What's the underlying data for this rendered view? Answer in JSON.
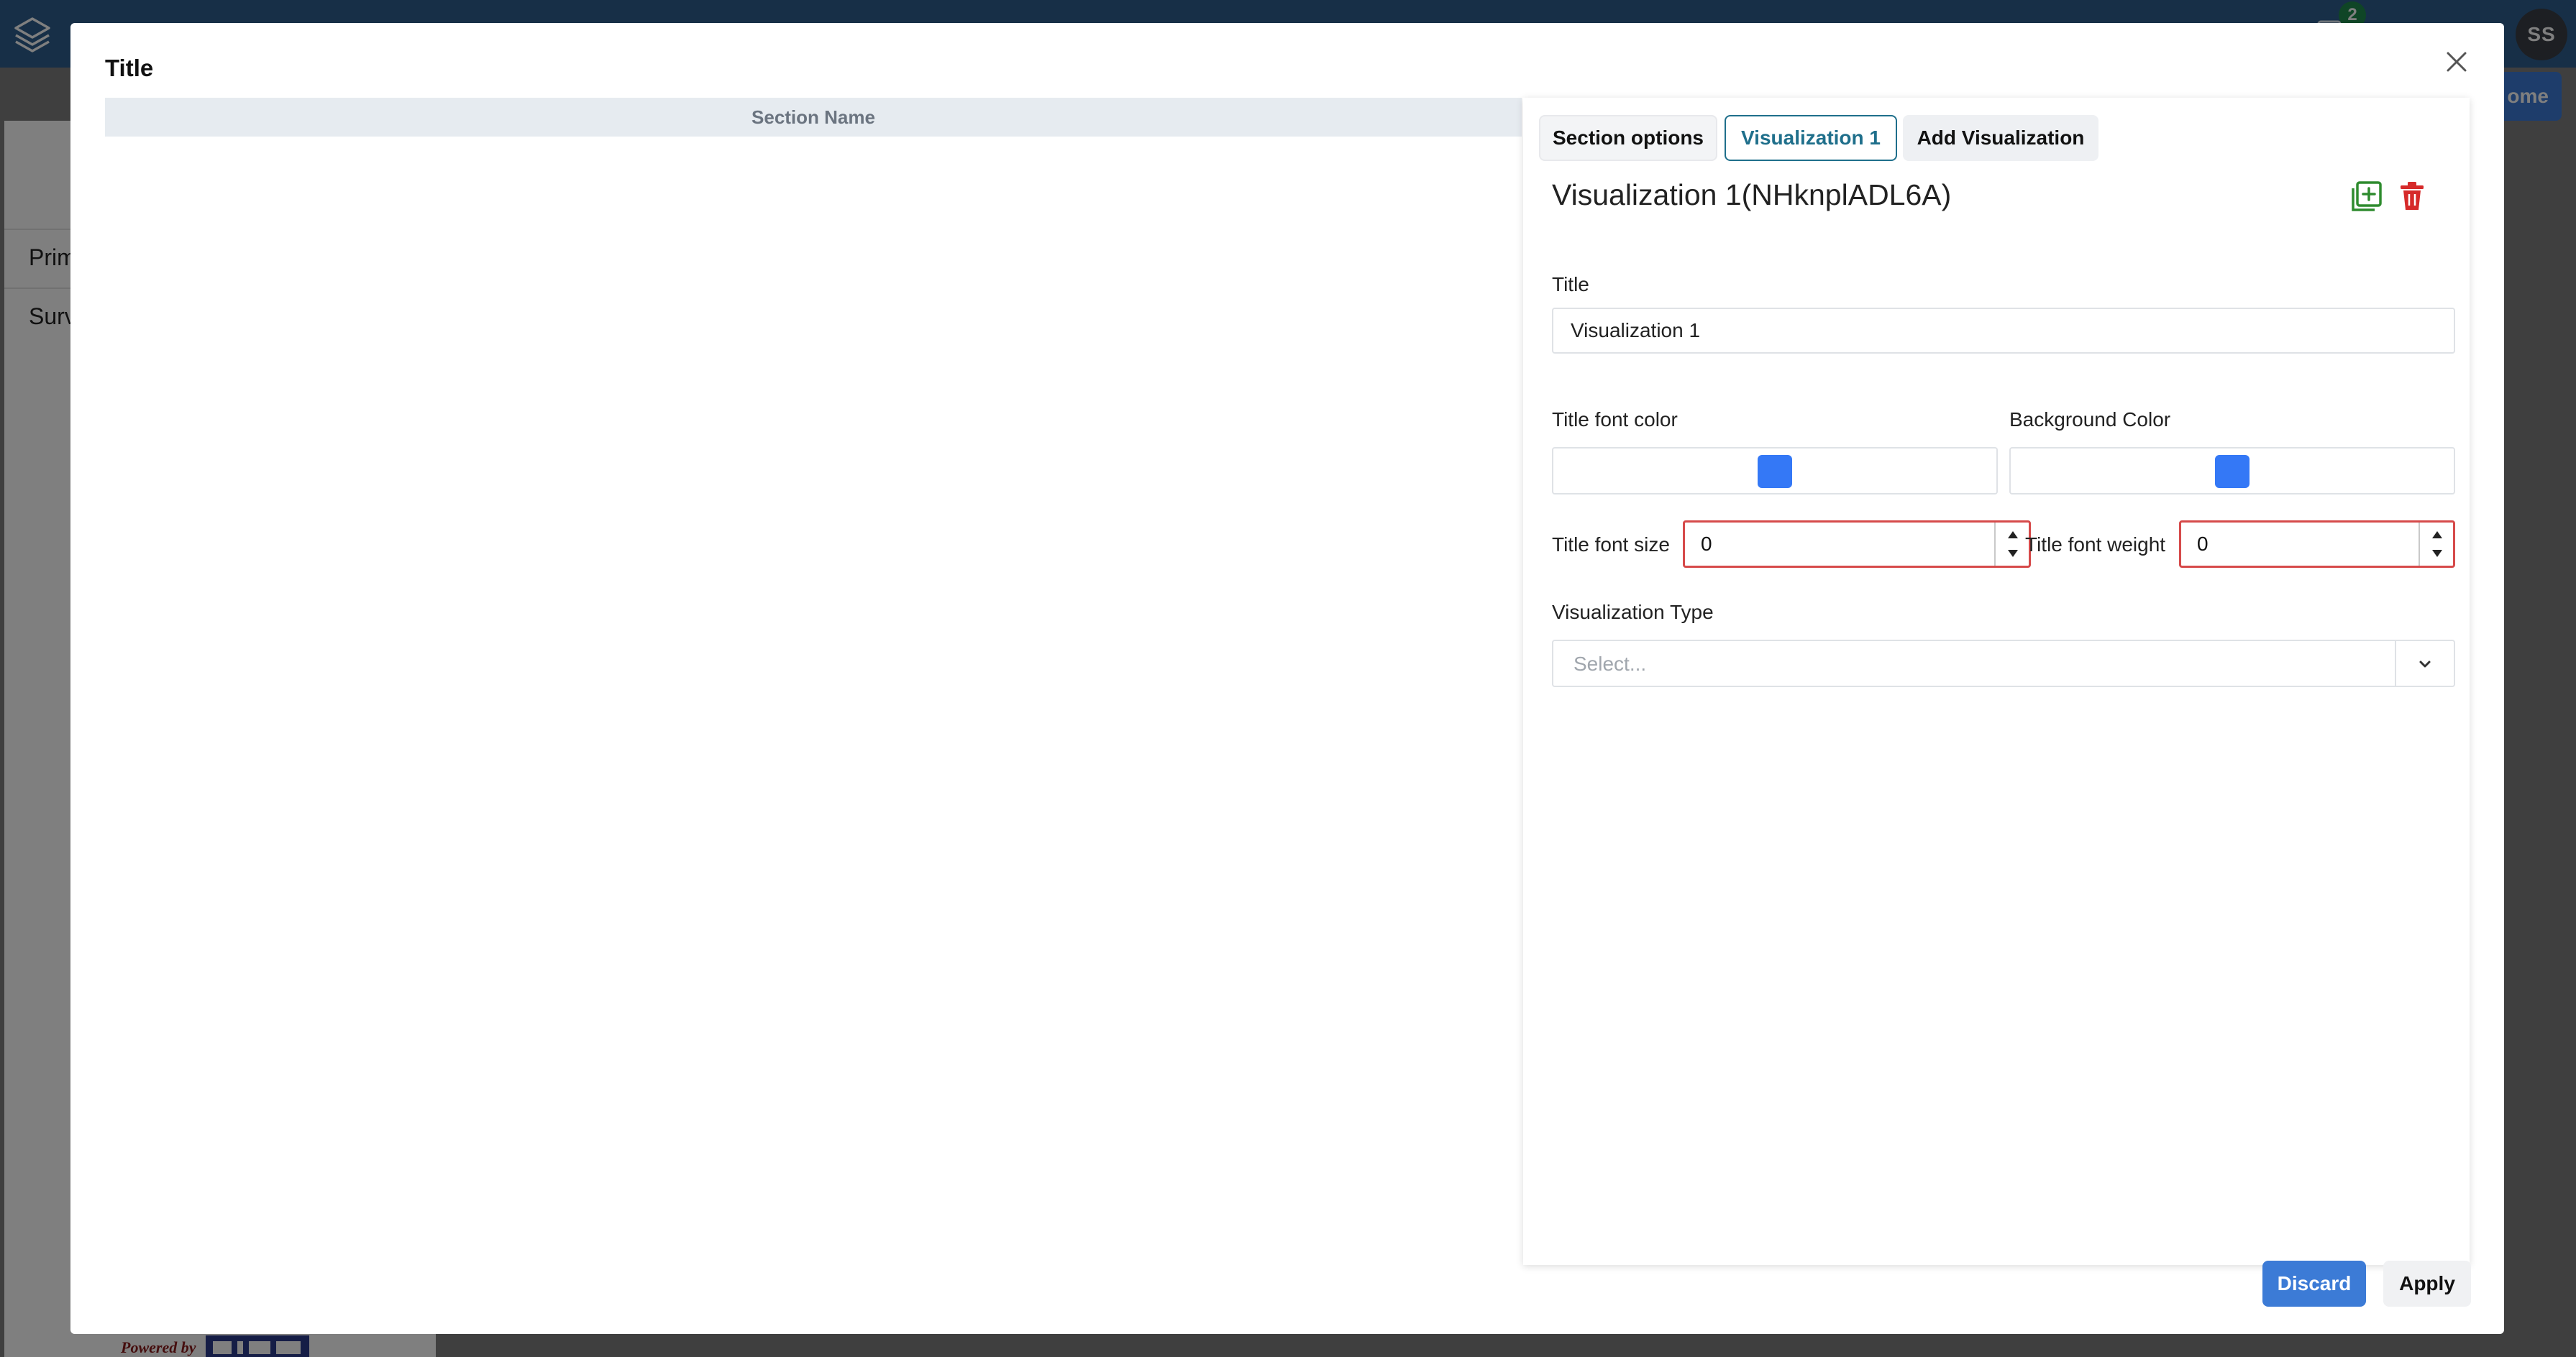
{
  "app": {
    "notification_count": "2",
    "avatar_initials": "SS",
    "background_list": [
      "Prim",
      "Surv"
    ],
    "home_button_label": "ome",
    "powered_by": "Powered by"
  },
  "modal": {
    "title": "Title",
    "section_name_header": "Section Name",
    "tabs": [
      {
        "label": "Section options",
        "active": false
      },
      {
        "label": "Visualization 1",
        "active": true
      },
      {
        "label": "Add Visualization",
        "active": false
      }
    ],
    "visualization_heading": "Visualization 1(NHknplADL6A)",
    "fields": {
      "title_label": "Title",
      "title_value": "Visualization 1",
      "title_font_color_label": "Title font color",
      "background_color_label": "Background Color",
      "title_font_color": "#3478f6",
      "background_color": "#3478f6",
      "title_font_size_label": "Title font size",
      "title_font_size_value": "0",
      "title_font_weight_label": "Title font weight",
      "title_font_weight_value": "0",
      "visualization_type_label": "Visualization Type",
      "visualization_type_placeholder": "Select..."
    },
    "buttons": {
      "discard": "Discard",
      "apply": "Apply"
    }
  },
  "colors": {
    "topbar": "#2e5f8f",
    "primary_button": "#3c7bd6",
    "active_tab": "#1f6f8b",
    "error_border": "#d64a4a",
    "copy_icon": "#2e8b2e",
    "trash_icon": "#d62a2a"
  },
  "icons": [
    "app-logo-icon",
    "notification-icon",
    "close-icon",
    "duplicate-icon",
    "trash-icon",
    "chevron-down-icon",
    "spinner-up-icon",
    "spinner-down-icon"
  ]
}
